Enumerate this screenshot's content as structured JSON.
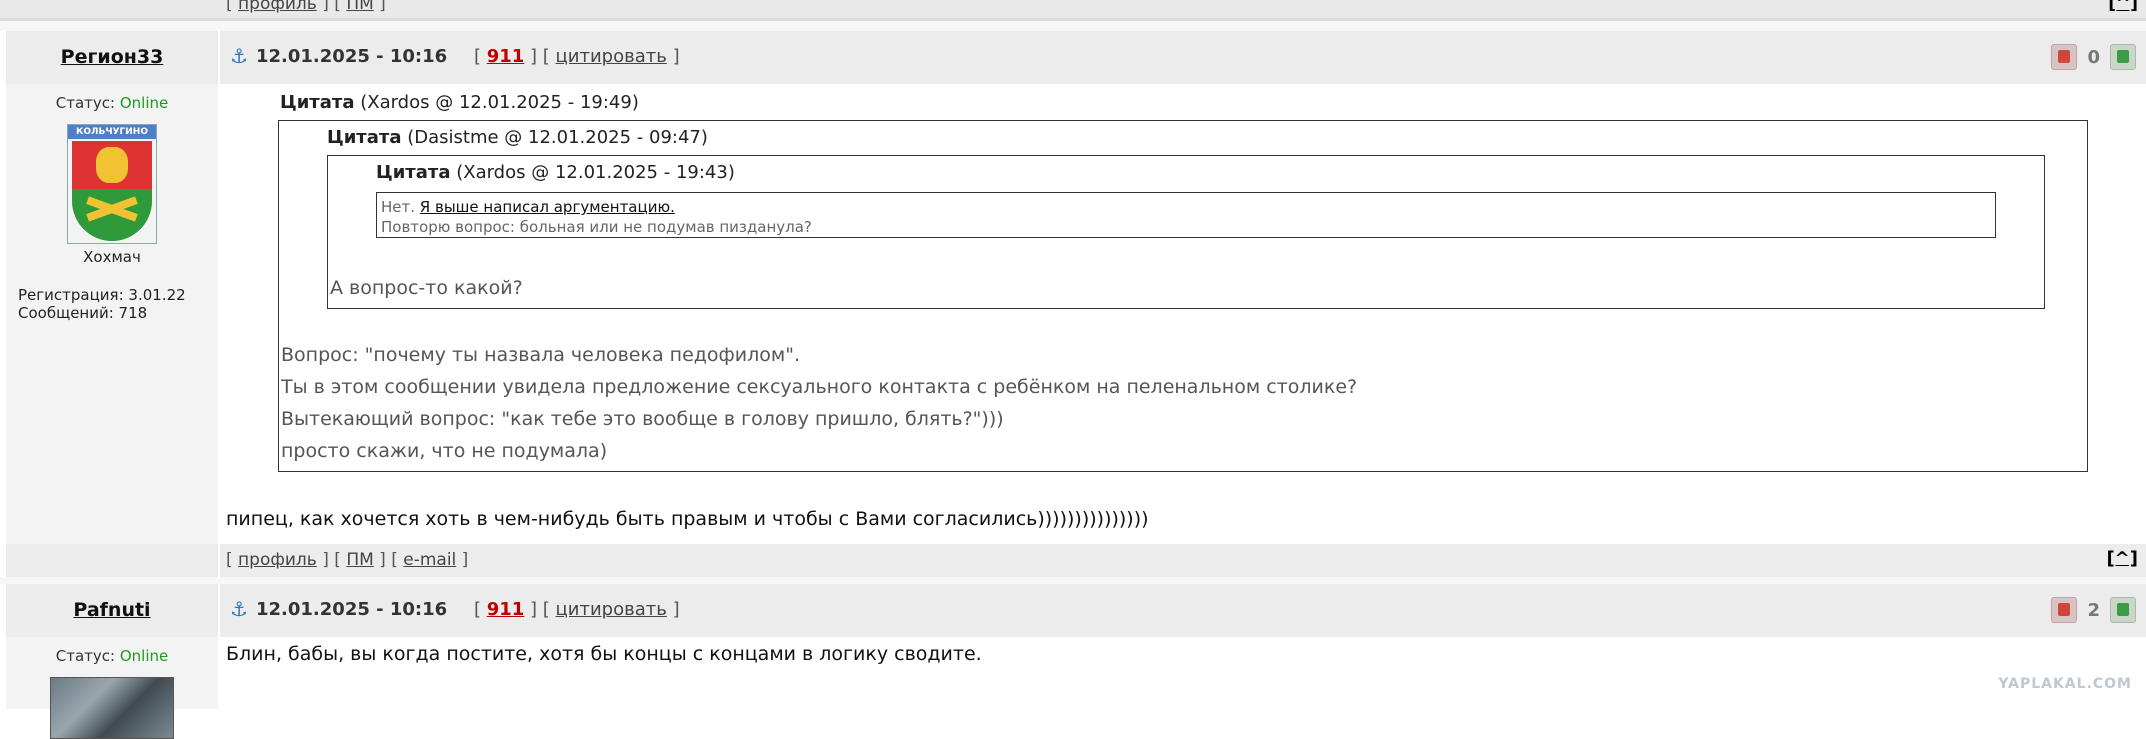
{
  "top_links": {
    "profile": "профиль",
    "pm": "ПМ",
    "up": "[^]"
  },
  "post1": {
    "author": "Регион33",
    "status_label": "Статус:",
    "status_value": "Online",
    "avatar_caption": "Хохмач",
    "avatar_banner": "КОЛЬЧУГИНО",
    "registration": "Регистрация: 3.01.22",
    "messages": "Сообщений: 718",
    "date": "12.01.2025 - 10:16",
    "number": "911",
    "quote_link": "цитировать",
    "votes": "0",
    "quote_outer": {
      "label": "Цитата",
      "meta": "(Xardos @ 12.01.2025 - 19:49)"
    },
    "quote_mid": {
      "label": "Цитата",
      "meta": "(Dasistme @ 12.01.2025 - 09:47)"
    },
    "quote_inner": {
      "label": "Цитата",
      "meta": "(Xardos @ 12.01.2025 - 19:43)"
    },
    "inner_line1_prefix": "Нет.",
    "inner_line1_link": "Я выше написал аргументацию.",
    "inner_line2": "Повторю вопрос: больная или не подумав пизданула?",
    "mid_reply": "А вопрос-то какой?",
    "outer_lines": [
      "Вопрос: \"почему ты назвала человека педофилом\".",
      "Ты в этом сообщении увидела предложение сексуального контакта с ребёнком на пеленальном столике?",
      "Вытекающий вопрос: \"как тебе это вообще в голову пришло, блять?\")))",
      "просто скажи, что не подумала)"
    ],
    "reply": "пипец, как хочется хоть в чем-нибудь быть правым и чтобы с Вами согласились)))))))))))))))",
    "footer": {
      "profile": "профиль",
      "pm": "ПМ",
      "email": "e-mail",
      "up": "[^]"
    }
  },
  "post2": {
    "author": "Pafnuti",
    "status_label": "Статус:",
    "status_value": "Online",
    "date": "12.01.2025 - 10:16",
    "number": "911",
    "quote_link": "цитировать",
    "votes": "2",
    "text": "Блин, бабы, вы когда постите, хотя бы концы с концами в логику сводите."
  },
  "watermark": "YAPLAKAL.COM"
}
